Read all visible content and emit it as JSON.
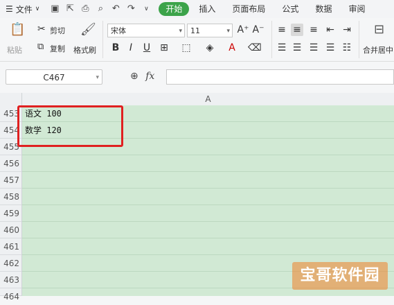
{
  "menubar": {
    "file_label": "文件",
    "tabs": [
      {
        "label": "开始",
        "active": true
      },
      {
        "label": "插入",
        "active": false
      },
      {
        "label": "页面布局",
        "active": false
      },
      {
        "label": "公式",
        "active": false
      },
      {
        "label": "数据",
        "active": false
      },
      {
        "label": "审阅",
        "active": false
      }
    ]
  },
  "ribbon": {
    "paste_label": "粘贴",
    "cut_label": "剪切",
    "copy_label": "复制",
    "format_painter_label": "格式刷",
    "font_name": "宋体",
    "font_size": "11",
    "merge_label": "合并居中"
  },
  "formula_bar": {
    "name_box": "C467",
    "fx_label": "fx",
    "formula_value": ""
  },
  "sheet": {
    "column_header": "A",
    "rows": [
      {
        "num": "453",
        "value": "语文 100"
      },
      {
        "num": "454",
        "value": "数学 120"
      },
      {
        "num": "455",
        "value": ""
      },
      {
        "num": "456",
        "value": ""
      },
      {
        "num": "457",
        "value": ""
      },
      {
        "num": "458",
        "value": ""
      },
      {
        "num": "459",
        "value": ""
      },
      {
        "num": "460",
        "value": ""
      },
      {
        "num": "461",
        "value": ""
      },
      {
        "num": "462",
        "value": ""
      },
      {
        "num": "463",
        "value": ""
      },
      {
        "num": "464",
        "value": ""
      }
    ]
  },
  "watermark": "宝哥软件园",
  "colors": {
    "accent": "#3ca34a",
    "grid_fill": "#d1e9d4",
    "highlight": "#e02020"
  }
}
